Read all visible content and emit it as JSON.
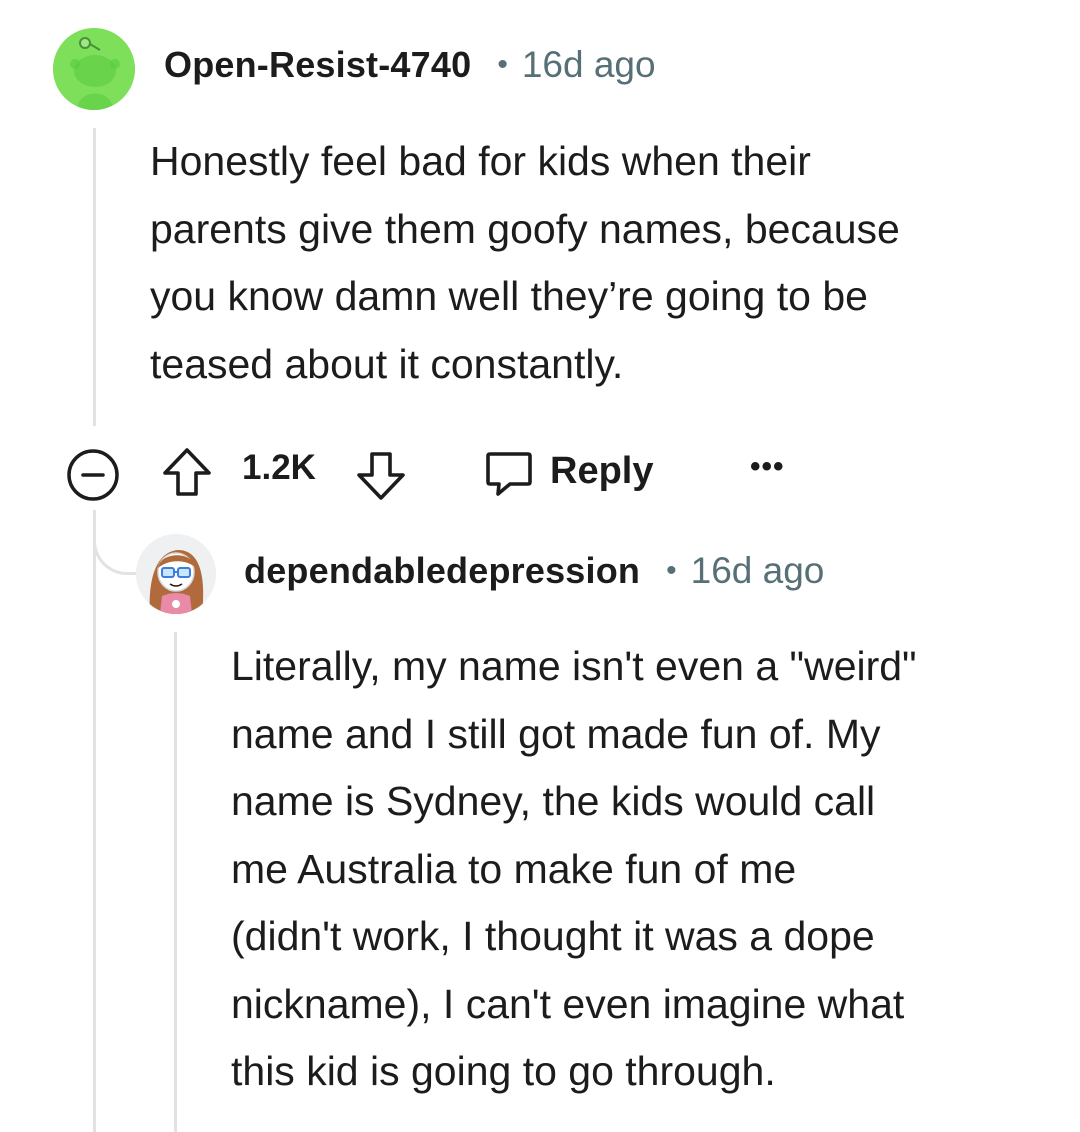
{
  "comments": [
    {
      "username": "Open-Resist-4740",
      "separator": "•",
      "age": "16d ago",
      "avatar_icon": "snoo-avatar-icon",
      "avatar_color": "#7ee05a",
      "lines": [
        "Honestly feel bad for kids when their",
        "parents give them goofy names, because",
        "you know damn well they’re going to be",
        "teased about it constantly."
      ],
      "actions": {
        "collapse_icon": "collapse-icon",
        "upvote_icon": "upvote-icon",
        "score": "1.2K",
        "downvote_icon": "downvote-icon",
        "reply_icon": "reply-icon",
        "reply_label": "Reply",
        "more_label": "•••"
      }
    },
    {
      "username": "dependabledepression",
      "separator": "•",
      "age": "16d ago",
      "avatar_icon": "user-avatar-icon",
      "lines": [
        "Literally, my name isn't even a \"weird\"",
        "name and I still got made fun of. My",
        "name is Sydney, the kids would call",
        "me Australia to make fun of me",
        "(didn't work, I thought it was a dope",
        "nickname), I can't even imagine what",
        "this kid is going to go through."
      ]
    }
  ]
}
